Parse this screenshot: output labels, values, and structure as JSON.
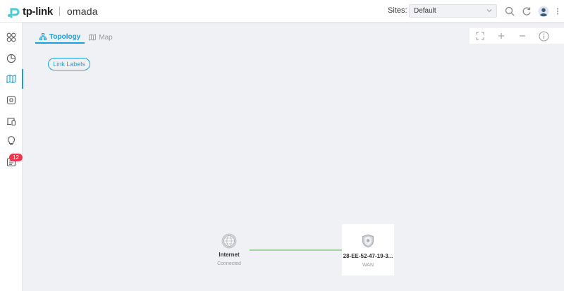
{
  "header": {
    "brand": "tp-link",
    "product": "omada",
    "sites_label": "Sites:",
    "site_value": "Default"
  },
  "sidebar": {
    "items": [
      {
        "icon": "dashboard-icon"
      },
      {
        "icon": "statistics-icon"
      },
      {
        "icon": "map-icon",
        "active": true
      },
      {
        "icon": "devices-icon"
      },
      {
        "icon": "clients-icon"
      },
      {
        "icon": "insights-icon"
      },
      {
        "icon": "logs-icon",
        "badge": "12"
      }
    ]
  },
  "tabs": [
    {
      "label": "Topology",
      "icon": "topology-icon",
      "active": true
    },
    {
      "label": "Map",
      "icon": "map-icon",
      "active": false
    }
  ],
  "toolbar": {
    "link_labels": "Link Labels"
  },
  "topology": {
    "internet": {
      "title": "Internet",
      "status": "Connected"
    },
    "gateway": {
      "title": "28-EE-52-47-19-3...",
      "subtitle": "WAN"
    }
  },
  "colors": {
    "accent": "#1e9ee0",
    "badge": "#f0344d",
    "link": "#9fd59f",
    "brand": "#4acbd6"
  }
}
